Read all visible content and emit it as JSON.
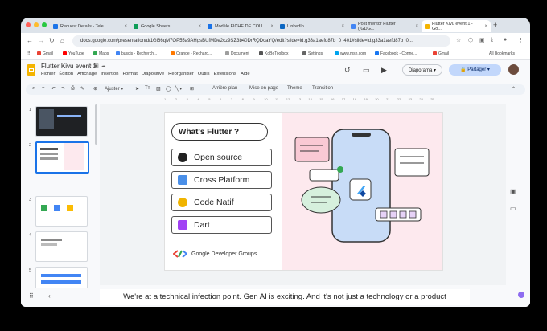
{
  "browser": {
    "tabs": [
      {
        "label": "Request Details - Tele...",
        "fav": "#1a73e8"
      },
      {
        "label": "Google Sheets",
        "fav": "#0f9d58"
      },
      {
        "label": "Modèle FICHE DE COU...",
        "fav": "#1a73e8"
      },
      {
        "label": "LinkedIn",
        "fav": "#0a66c2"
      },
      {
        "label": "Post mentor Flutter ( GDG...",
        "fav": "#4285f4"
      },
      {
        "label": "Flutter Kivu event 1 - Go...",
        "fav": "#f4b400"
      }
    ],
    "url": "docs.google.com/presentation/d/1Gl66qM7OP55a9AHgsBUfMDe2cz9SZ3b40DrRQDcaYQ/edit?slide=id.g33a1aefd87b_0_401#slide=id.g33a1aefd87b_0...",
    "bookmarks": [
      "Gmail",
      "YouTube",
      "Maps",
      "bascis - Recherch...",
      "Orange - Recharg...",
      "Document",
      "KoBoToolbox",
      "Settings",
      "www.msn.com",
      "Facebook - Conne...",
      "Gmail"
    ],
    "all_bookmarks": "All Bookmarks"
  },
  "app": {
    "title": "Flutter Kivu event 1",
    "menu": [
      "Fichier",
      "Édition",
      "Affichage",
      "Insertion",
      "Format",
      "Diapositive",
      "Réorganiser",
      "Outils",
      "Extensions",
      "Aide"
    ],
    "slideshow_label": "Diaporama",
    "share_label": "Partager"
  },
  "toolbar": {
    "fit_label": "Ajuster",
    "background_label": "Arrière-plan",
    "layout_label": "Mise en page",
    "theme_label": "Thème",
    "transition_label": "Transition"
  },
  "ruler": [
    "1",
    "2",
    "3",
    "4",
    "5",
    "6",
    "7",
    "8",
    "9",
    "10",
    "11",
    "12",
    "13",
    "14",
    "15",
    "16",
    "17",
    "18",
    "19",
    "20",
    "21",
    "22",
    "23",
    "24",
    "25"
  ],
  "thumbnails": [
    "1",
    "2",
    "3",
    "4",
    "5"
  ],
  "slide": {
    "title": "What's Flutter ?",
    "items": [
      {
        "label": "Open source",
        "icon": "github-icon",
        "color": "#222222"
      },
      {
        "label": "Cross Platform",
        "icon": "devices-icon",
        "color": "#4a8fe8"
      },
      {
        "label": "Code Natif",
        "icon": "gauge-icon",
        "color": "#f0b400"
      },
      {
        "label": "Dart",
        "icon": "code-icon",
        "color": "#a142f4"
      }
    ],
    "brand": "Google Developer Groups"
  },
  "caption": "We're at a technical infection point. Gen AI is exciting. And it's not just a technology or a product"
}
